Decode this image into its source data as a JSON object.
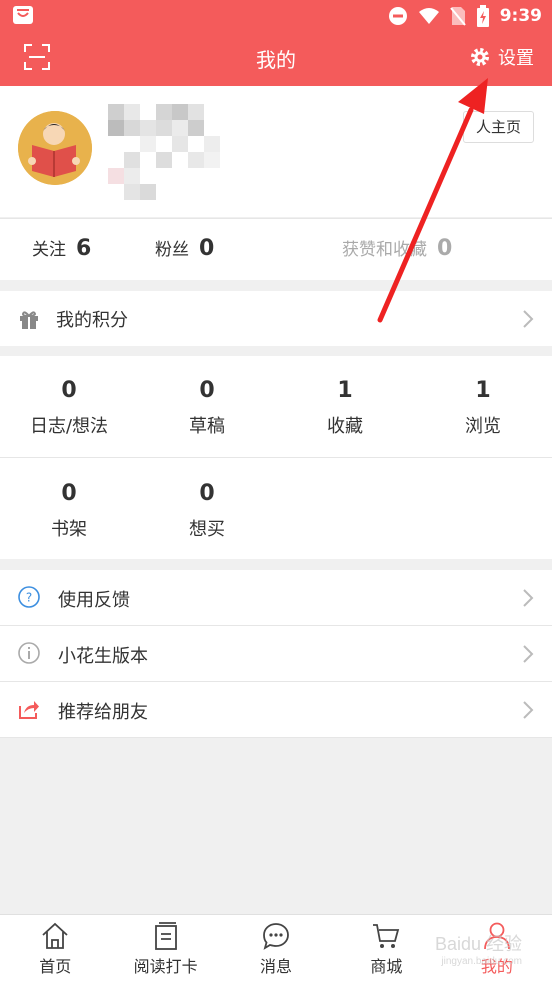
{
  "status": {
    "time": "9:39"
  },
  "header": {
    "title": "我的",
    "settings_label": "设置"
  },
  "profile": {
    "homepage_label": "人主页"
  },
  "stats": [
    {
      "label": "关注",
      "value": "6"
    },
    {
      "label": "粉丝",
      "value": "0"
    },
    {
      "label": "获赞和收藏",
      "value": "0"
    }
  ],
  "points": {
    "label": "我的积分"
  },
  "counts": [
    {
      "label": "日志/想法",
      "value": "0"
    },
    {
      "label": "草稿",
      "value": "0"
    },
    {
      "label": "收藏",
      "value": "1"
    },
    {
      "label": "浏览",
      "value": "1"
    },
    {
      "label": "书架",
      "value": "0"
    },
    {
      "label": "想买",
      "value": "0"
    }
  ],
  "menu": [
    {
      "label": "使用反馈",
      "icon": "question-icon"
    },
    {
      "label": "小花生版本",
      "icon": "info-icon"
    },
    {
      "label": "推荐给朋友",
      "icon": "share-icon"
    }
  ],
  "nav": [
    {
      "label": "首页",
      "icon": "home-icon"
    },
    {
      "label": "阅读打卡",
      "icon": "book-icon"
    },
    {
      "label": "消息",
      "icon": "message-icon"
    },
    {
      "label": "商城",
      "icon": "cart-icon"
    },
    {
      "label": "我的",
      "icon": "user-icon",
      "active": true
    }
  ],
  "watermark": {
    "text": "Baidu 经验",
    "sub": "jingyan.baidu.com"
  },
  "colors": {
    "accent": "#f45b5b",
    "annotation": "#ee2222"
  }
}
